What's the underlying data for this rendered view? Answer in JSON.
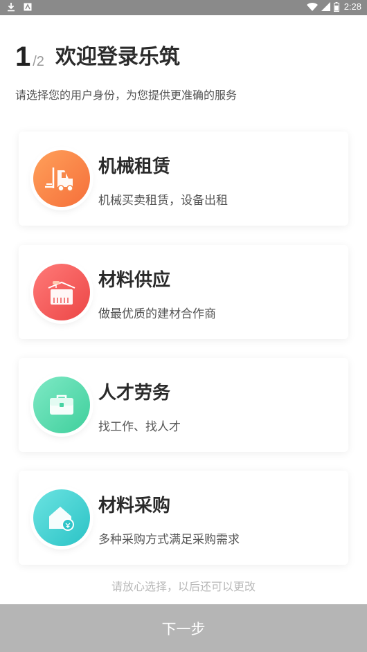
{
  "status_bar": {
    "time": "2:28",
    "left_icons": [
      "download-icon",
      "notification-icon"
    ],
    "right_icons": [
      "wifi-icon",
      "signal-icon",
      "battery-icon"
    ]
  },
  "header": {
    "step_current": "1",
    "step_total": "/2",
    "title": "欢迎登录乐筑",
    "subtitle": "请选择您的用户身份，为您提供更准确的服务"
  },
  "roles": [
    {
      "title": "机械租赁",
      "desc": "机械买卖租赁，设备出租",
      "icon": "forklift-icon",
      "color": "#f6793f"
    },
    {
      "title": "材料供应",
      "desc": "做最优质的建材合作商",
      "icon": "warehouse-icon",
      "color": "#ee4b4b"
    },
    {
      "title": "人才劳务",
      "desc": "找工作、找人才",
      "icon": "briefcase-icon",
      "color": "#43d1a0"
    },
    {
      "title": "材料采购",
      "desc": "多种采购方式满足采购需求",
      "icon": "shop-house-icon",
      "color": "#2fc5c8"
    }
  ],
  "footer": {
    "hint": "请放心选择，以后还可以更改",
    "next_label": "下一步"
  }
}
